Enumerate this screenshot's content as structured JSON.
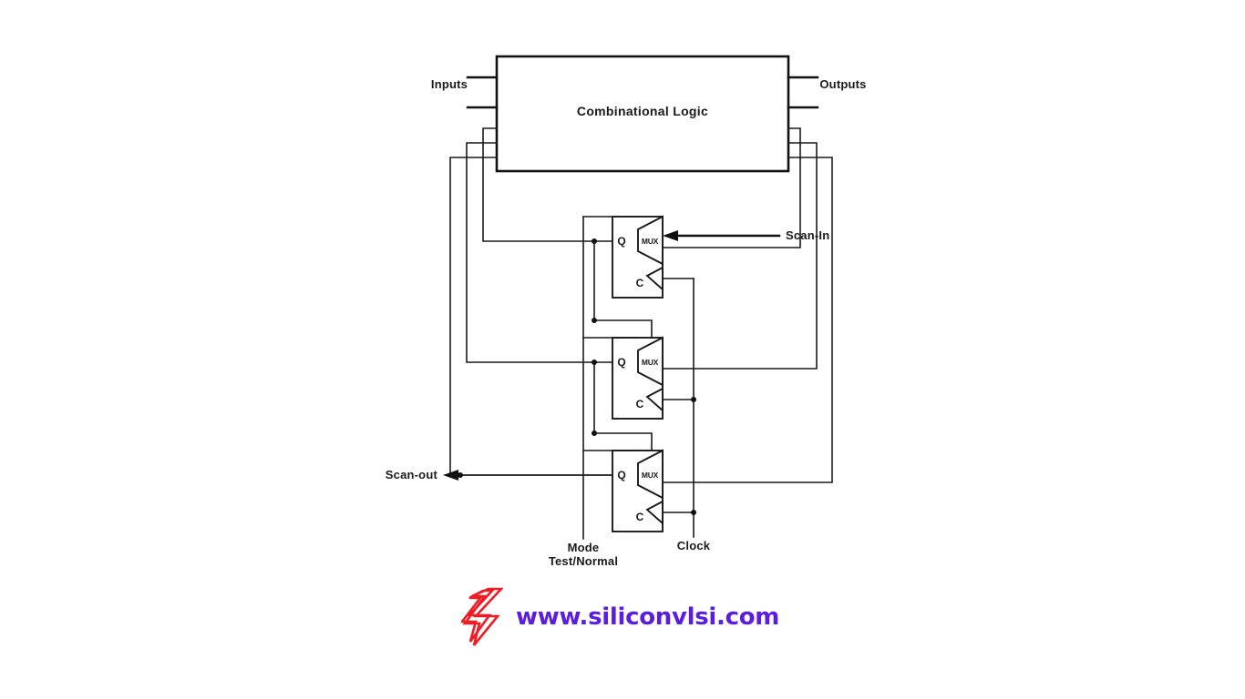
{
  "diagram": {
    "title": "Scan chain design-for-test (mux-scan) block diagram",
    "blocks": {
      "combinational_logic": {
        "label": "Combinational Logic"
      }
    },
    "port_labels": {
      "inputs": "Inputs",
      "outputs": "Outputs",
      "scan_in": "Scan-In",
      "scan_out": "Scan-out",
      "mode_line1": "Mode",
      "mode_line2": "Test/Normal",
      "clock": "Clock"
    },
    "cells": [
      {
        "q_label": "Q",
        "mux_label": "MUX",
        "clk_label": "C"
      },
      {
        "q_label": "Q",
        "mux_label": "MUX",
        "clk_label": "C"
      },
      {
        "q_label": "Q",
        "mux_label": "MUX",
        "clk_label": "C"
      }
    ],
    "colors": {
      "ink": "#1a1a1a",
      "background": "#ffffff",
      "watermark_text": "#5b1ee0",
      "watermark_logo": "#ee1c25"
    }
  },
  "watermark": {
    "url_text": "www.siliconvlsi.com",
    "logo_name": "siliconvlsi-bolt-logo"
  }
}
